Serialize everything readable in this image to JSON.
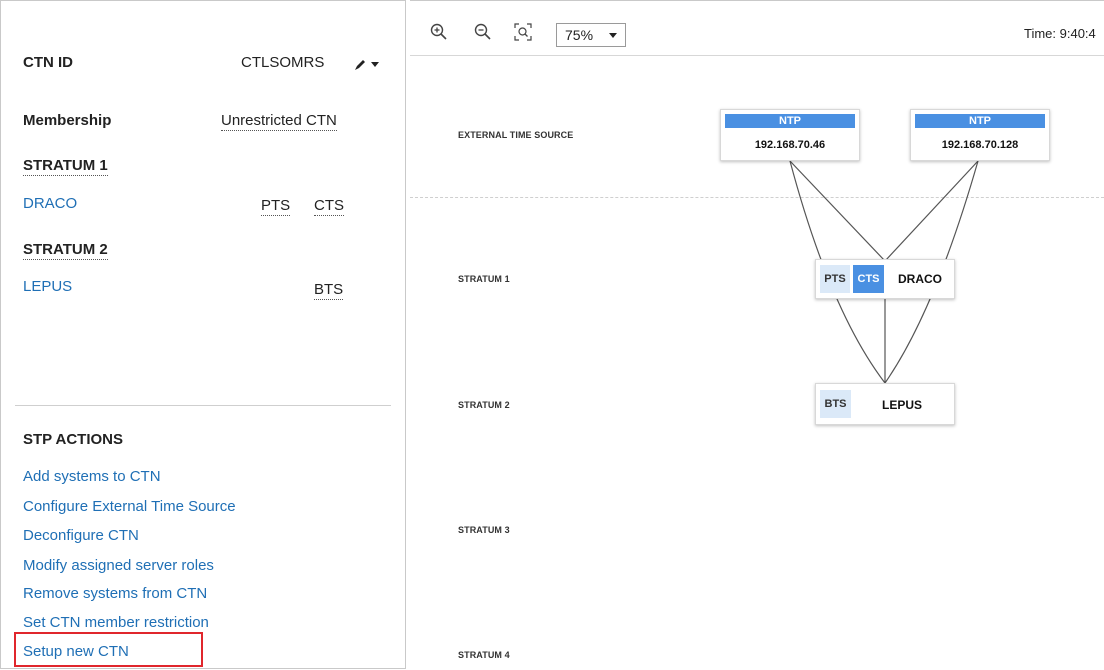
{
  "ctn": {
    "id_label": "CTN ID",
    "id_value": "CTLSOMRS",
    "membership_label": "Membership",
    "membership_value": "Unrestricted CTN"
  },
  "stratum_list": [
    {
      "heading": "STRATUM 1",
      "system": "DRACO",
      "roles": [
        "PTS",
        "CTS"
      ]
    },
    {
      "heading": "STRATUM 2",
      "system": "LEPUS",
      "roles": [
        "BTS"
      ]
    }
  ],
  "stp_actions": {
    "heading": "STP ACTIONS",
    "items": [
      "Add systems to CTN",
      "Configure External Time Source",
      "Deconfigure CTN",
      "Modify assigned server roles",
      "Remove systems from CTN",
      "Set CTN member restriction",
      "Setup new CTN"
    ],
    "highlighted": "Setup new CTN"
  },
  "toolbar": {
    "zoom_in_icon": "zoom-in-icon",
    "zoom_out_icon": "zoom-out-icon",
    "fit_icon": "zoom-fit-icon",
    "zoom_value": "75%",
    "time_text": "Time: 9:40:4"
  },
  "topology": {
    "row_labels": [
      "EXTERNAL TIME SOURCE",
      "STRATUM 1",
      "STRATUM 2",
      "STRATUM 3",
      "STRATUM 4"
    ],
    "ntp_servers": [
      {
        "type": "NTP",
        "ip": "192.168.70.46"
      },
      {
        "type": "NTP",
        "ip": "192.168.70.128"
      }
    ],
    "systems": [
      {
        "name": "DRACO",
        "roles": [
          "PTS",
          "CTS"
        ],
        "active_role": "CTS"
      },
      {
        "name": "LEPUS",
        "roles": [
          "BTS"
        ]
      }
    ]
  },
  "colors": {
    "link": "#1f6fb5",
    "ntp_header": "#4a90e2",
    "role_light": "#dbe9f8",
    "highlight_box": "#e0262c"
  }
}
